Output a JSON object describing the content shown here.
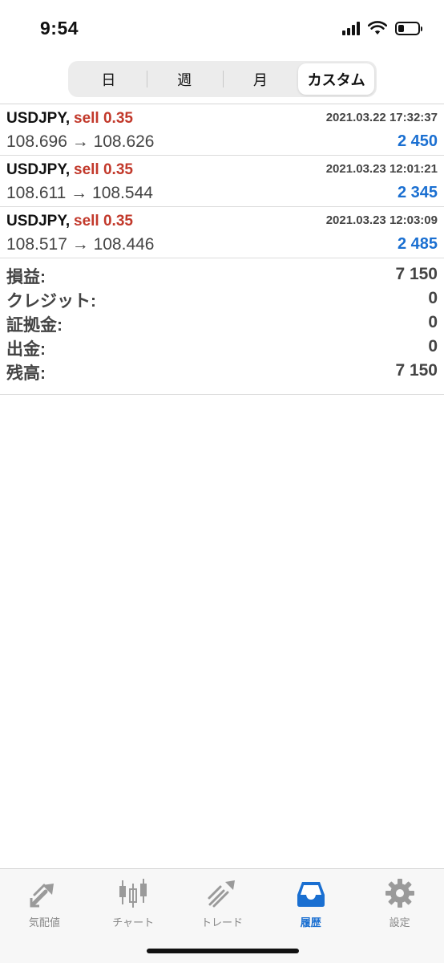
{
  "status_bar": {
    "time": "9:54",
    "battery_level": 0.3
  },
  "period_tabs": [
    {
      "label": "日",
      "active": false
    },
    {
      "label": "週",
      "active": false
    },
    {
      "label": "月",
      "active": false
    },
    {
      "label": "カスタム",
      "active": true
    }
  ],
  "trades": [
    {
      "symbol": "USDJPY,",
      "side": "sell 0.35",
      "time": "2021.03.22 17:32:37",
      "prices": "108.696 → 108.626",
      "profit": "2 450"
    },
    {
      "symbol": "USDJPY,",
      "side": "sell 0.35",
      "time": "2021.03.23 12:01:21",
      "prices": "108.611 → 108.544",
      "profit": "2 345"
    },
    {
      "symbol": "USDJPY,",
      "side": "sell 0.35",
      "time": "2021.03.23 12:03:09",
      "prices": "108.517 → 108.446",
      "profit": "2 485"
    }
  ],
  "summary": [
    {
      "label": "損益:",
      "value": "7 150"
    },
    {
      "label": "クレジット:",
      "value": "0"
    },
    {
      "label": "証拠金:",
      "value": "0"
    },
    {
      "label": "出金:",
      "value": "0"
    },
    {
      "label": "残高:",
      "value": "7 150"
    }
  ],
  "tab_bar": [
    {
      "label": "気配値",
      "icon": "quotes-icon",
      "active": false
    },
    {
      "label": "チャート",
      "icon": "chart-icon",
      "active": false
    },
    {
      "label": "トレード",
      "icon": "trade-icon",
      "active": false
    },
    {
      "label": "履歴",
      "icon": "history-icon",
      "active": true
    },
    {
      "label": "設定",
      "icon": "settings-icon",
      "active": false
    }
  ],
  "colors": {
    "sell": "#c2392b",
    "profit": "#1a6fd1",
    "text": "#444444",
    "tab_active": "#1a6fd1",
    "tab_inactive": "#9a9a9a"
  }
}
